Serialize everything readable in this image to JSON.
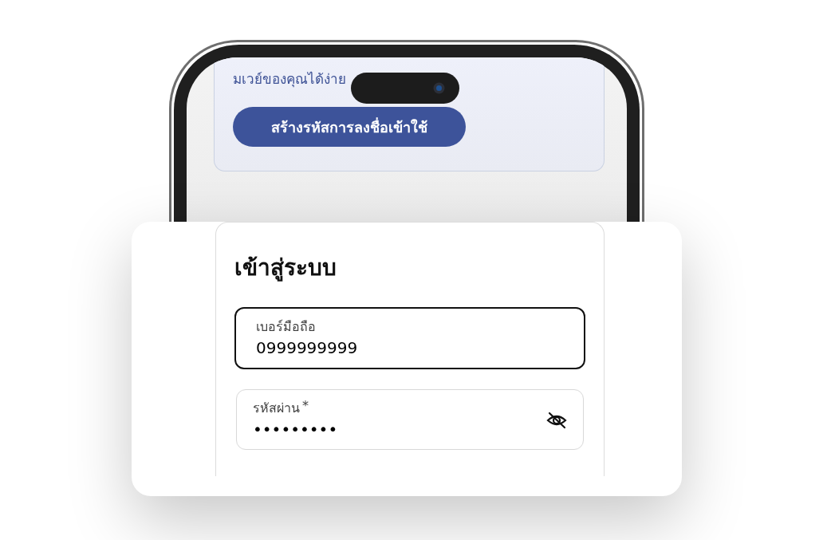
{
  "phone_screen": {
    "info_card": {
      "text": "มเวย์ของคุณได้ง่าย",
      "button": "สร้างรหัสการลงชื่อเข้าใช้"
    }
  },
  "login": {
    "title": "เข้าสู่ระบบ",
    "fields": [
      {
        "kind": "text",
        "label": "เบอร์มือถือ",
        "value": "0999999999",
        "focused": true
      },
      {
        "kind": "password",
        "label": "รหัสผ่าน",
        "required_mark": "*",
        "value": "•••••••••",
        "focused": false
      }
    ]
  }
}
